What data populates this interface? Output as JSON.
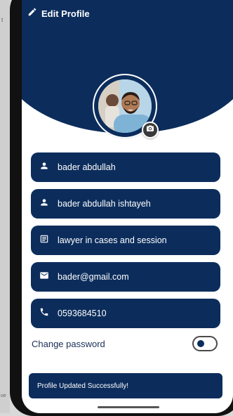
{
  "app": {
    "title": "Edit Profile"
  },
  "profile": {
    "name": "bader abdullah",
    "full_name": "bader abdullah ishtayeh",
    "bio": "lawyer in cases and session",
    "email": "bader@gmail.com",
    "phone": "0593684510"
  },
  "settings": {
    "change_password_label": "Change password",
    "change_password_enabled": false
  },
  "snackbar": {
    "message": "Profile Updated Successfully!"
  },
  "side": {
    "top_text": "t",
    "bottom_text": "oe"
  },
  "colors": {
    "primary": "#0c2d5c",
    "background": "#ffffff",
    "text_on_primary": "#ffffff"
  },
  "icons": {
    "title": "edit-icon",
    "avatar_action": "camera-icon",
    "name": "person-icon",
    "full_name": "person-icon",
    "bio": "description-icon",
    "email": "mail-icon",
    "phone": "phone-icon"
  }
}
